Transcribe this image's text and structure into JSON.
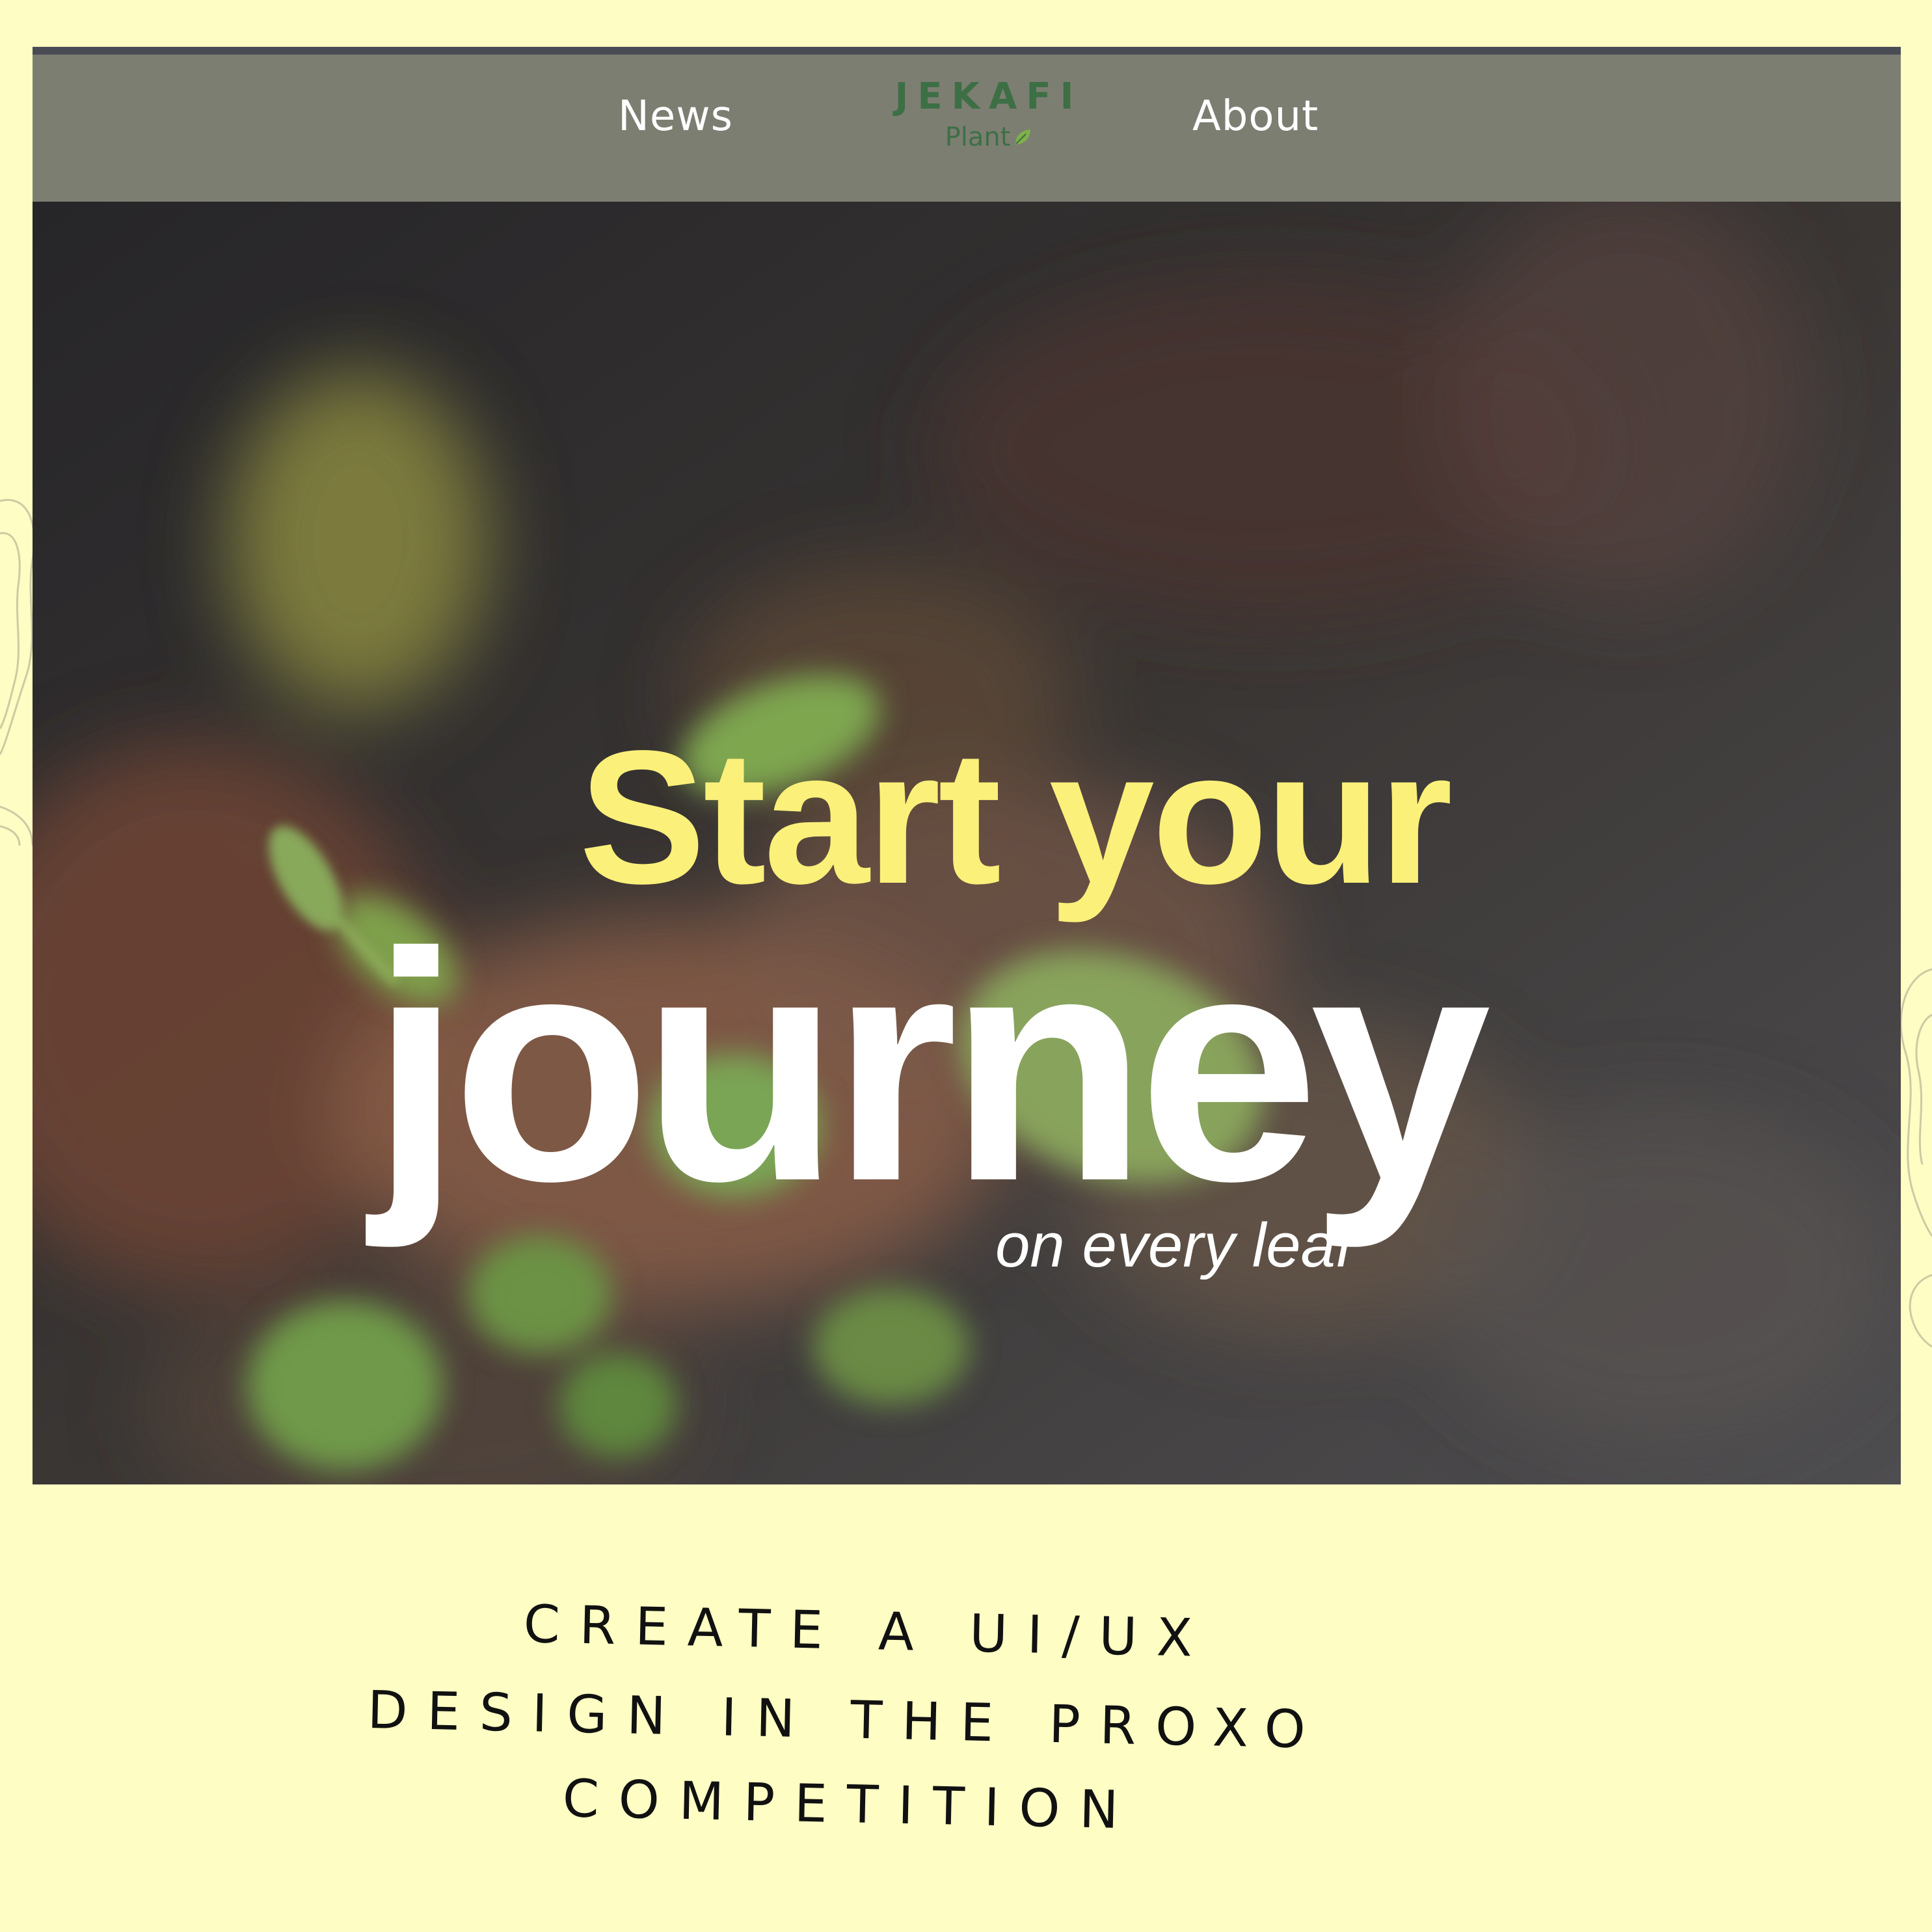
{
  "nav": {
    "news_label": "News",
    "about_label": "About",
    "logo": {
      "word": "JEKAFI",
      "sub": "Plant",
      "icon": "leaf-icon"
    }
  },
  "hero": {
    "headline_line1": "Start your",
    "headline_line2": "journey",
    "tagline": "on every leaf"
  },
  "caption": {
    "line1": "CREATE A UI/UX",
    "line2": "DESIGN IN THE PROXO",
    "line3": "COMPETITION"
  },
  "colors": {
    "page_background": "#fdfdc4",
    "navbar": "#7d7e72",
    "headline_accent": "#fbf07a",
    "logo_green": "#3d6f45",
    "text_white": "#ffffff"
  }
}
